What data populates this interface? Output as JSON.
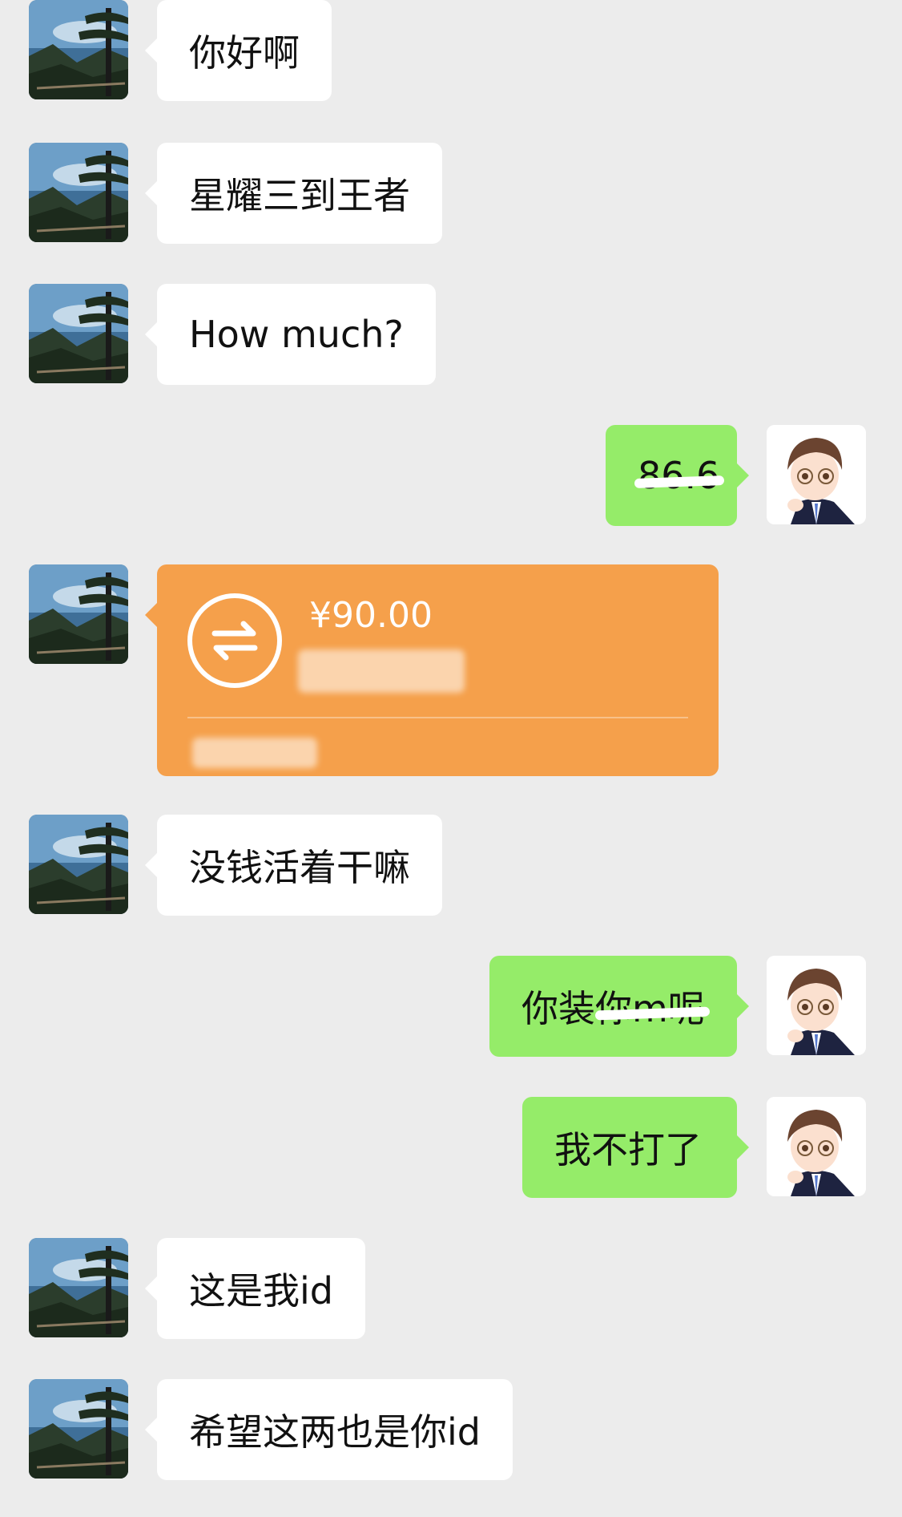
{
  "messages": [
    {
      "side": "in",
      "text": "你好啊"
    },
    {
      "side": "in",
      "text": "星耀三到王者"
    },
    {
      "side": "in",
      "text": "How much?"
    },
    {
      "side": "out",
      "text": "86.6",
      "note": "scribbled-out"
    },
    {
      "side": "in",
      "type": "transfer",
      "amount": "¥90.00"
    },
    {
      "side": "in",
      "text": "没钱活着干嘛"
    },
    {
      "side": "out",
      "text": "你装你m呢",
      "note": "partially scribbled-out"
    },
    {
      "side": "out",
      "text": "我不打了"
    },
    {
      "side": "in",
      "text": "这是我id"
    },
    {
      "side": "in",
      "text": "希望这两也是你id"
    }
  ],
  "colors": {
    "background": "#ececec",
    "incoming": "#ffffff",
    "outgoing": "#95ec69",
    "transfer": "#f5a04b"
  },
  "icons": {
    "contact_avatar": "landscape-pine-avatar",
    "self_avatar": "cartoon-boy-avatar",
    "transfer": "transfer-arrows-icon"
  }
}
